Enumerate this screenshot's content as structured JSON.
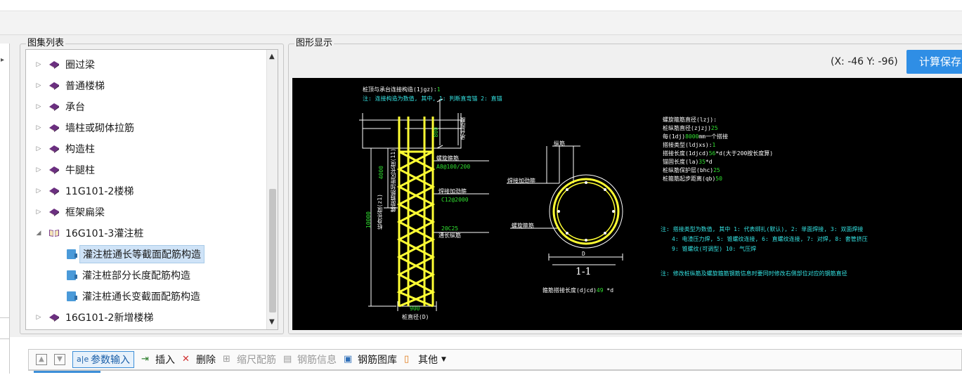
{
  "panels": {
    "atlas_list_title": "图集列表",
    "graphic_display_title": "图形显示"
  },
  "tree": {
    "items": [
      {
        "label": "圈过梁",
        "type": "book",
        "expanded": false
      },
      {
        "label": "普通楼梯",
        "type": "book",
        "expanded": false
      },
      {
        "label": "承台",
        "type": "book",
        "expanded": false
      },
      {
        "label": "墙柱或砌体拉筋",
        "type": "book",
        "expanded": false
      },
      {
        "label": "构造柱",
        "type": "book",
        "expanded": false
      },
      {
        "label": "牛腿柱",
        "type": "book",
        "expanded": false
      },
      {
        "label": "11G101-2楼梯",
        "type": "book",
        "expanded": false
      },
      {
        "label": "框架扁梁",
        "type": "book",
        "expanded": false
      },
      {
        "label": "16G101-3灌注桩",
        "type": "book-open",
        "expanded": true
      },
      {
        "label": "灌注桩通长等截面配筋构造",
        "type": "doc",
        "selected": true
      },
      {
        "label": "灌注桩部分长度配筋构造",
        "type": "doc"
      },
      {
        "label": "灌注桩通长变截面配筋构造",
        "type": "doc"
      },
      {
        "label": "16G101-2新增楼梯",
        "type": "book",
        "expanded": false
      }
    ]
  },
  "viewer": {
    "coords": "(X: -46 Y: -96)",
    "calc_save_button": "计算保存"
  },
  "cad": {
    "title_line1": "桩顶与承台连接构造(1jgz):",
    "title_line1_value": "1",
    "title_line2": "注: 连接构造为数值, 其中, 1: 判断直弯锚    2: 直锚",
    "dim_800": "800",
    "cap_label": "承台厚度",
    "dim_4000": "4000",
    "spiral_length_label": "螺旋箍筋加密区长度(11)",
    "dim_10000": "10000",
    "pile_length_label": "桩身长度(z1)",
    "spiral_stirrup_label": "螺旋箍筋",
    "spiral_stirrup_value": "A8@100/200",
    "spiral_reinf_label": "焊接加劲箍",
    "spiral_reinf_value": "C12@2000",
    "long_bar_value": "20C25",
    "long_bar_label": "通长纵筋",
    "dim_900": "900",
    "pile_dia_label": "桩直径(D)",
    "section_long_label": "纵筋",
    "section_weld_label": "焊接加劲箍",
    "section_spiral_label": "螺旋箍筋",
    "section_D": "D",
    "section_name": "1-1",
    "lap_length_label": "箍筋搭接长度(djcd)",
    "lap_length_value": "49",
    "lap_length_unit": "*d",
    "params": [
      {
        "label": "螺旋箍筋直径(lzj):",
        "value": ""
      },
      {
        "label": "桩纵筋直径(zjzj)",
        "value": "25"
      },
      {
        "label": "每(1dj)",
        "value": "8000",
        "suffix": "mm一个搭接"
      },
      {
        "label": "搭接类型(ldjxs):",
        "value": "1"
      },
      {
        "label": "搭接长度(1djcd)",
        "value": "56",
        "suffix": "*d(大于200按长度算)"
      },
      {
        "label": "锚固长度(la)",
        "value": "35",
        "suffix": "*d"
      },
      {
        "label": "桩纵筋保护层(bhc)",
        "value": "25"
      },
      {
        "label": "桩箍筋起步距离(qb)",
        "value": "50"
      }
    ],
    "note1": "注: 搭接类型为数值, 其中 1: 代表绑扎(默认), 2: 单面焊接, 3: 双面焊接",
    "note1b": "4: 电渣压力焊, 5: 锥螺纹连接, 6: 直螺纹连接, 7: 对焊, 8: 套管挤压",
    "note1c": "9: 锥螺纹(可调型) 10: 气压焊",
    "note2": "注: 修改桩纵筋及螺旋箍筋钢筋信息时要同时修改右侧部位对应的钢筋直径"
  },
  "toolbar": {
    "param_input": "参数输入",
    "insert": "插入",
    "delete": "删除",
    "scale_rebar": "缩尺配筋",
    "rebar_info": "钢筋信息",
    "rebar_library": "钢筋图库",
    "other": "其他"
  }
}
